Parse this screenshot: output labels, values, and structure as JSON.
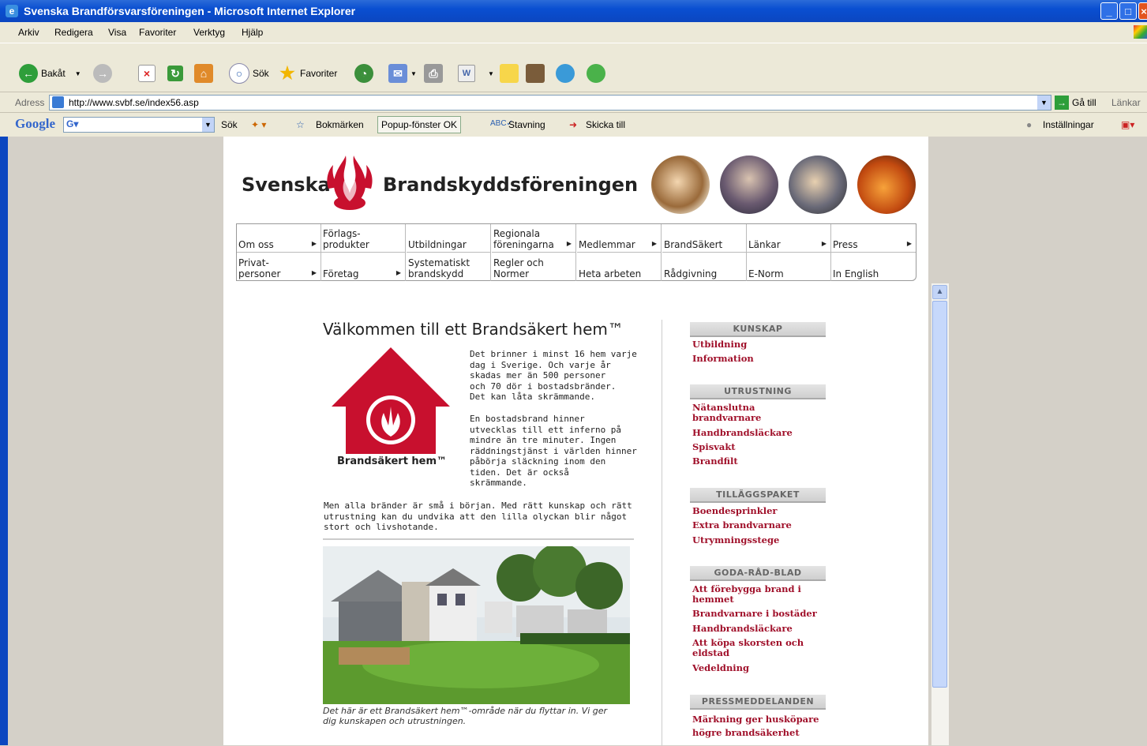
{
  "window": {
    "title": "Svenska Brandförsvarsföreningen - Microsoft Internet Explorer"
  },
  "menu": [
    "Arkiv",
    "Redigera",
    "Visa",
    "Favoriter",
    "Verktyg",
    "Hjälp"
  ],
  "toolbar": {
    "back": "Bakåt",
    "search": "Sök",
    "favorites": "Favoriter"
  },
  "address": {
    "label": "Adress",
    "url": "http://www.svbf.se/index56.asp",
    "go": "Gå till",
    "links": "Länkar"
  },
  "googlebar": {
    "logo": "Google",
    "search": "Sök",
    "bookmarks": "Bokmärken",
    "popup": "Popup-fönster OK",
    "spelling": "Stavning",
    "send": "Skicka till",
    "settings": "Inställningar"
  },
  "logo": {
    "left": "Svenska",
    "right": "Brandskyddsföreningen"
  },
  "nav": {
    "row1": [
      "Om oss",
      "Förlags-\nprodukter",
      "Utbildningar",
      "Regionala\nföreningarna",
      "Medlemmar",
      "BrandSäkert",
      "Länkar",
      "Press"
    ],
    "row2": [
      "Privat-\npersoner",
      "Företag",
      "Systematiskt\nbrandskydd",
      "Regler och\nNormer",
      "Heta arbeten",
      "Rådgivning",
      "E-Norm",
      "In English"
    ]
  },
  "main": {
    "title": "Välkommen till ett Brandsäkert hem™",
    "house_label": "Brandsäkert hem™",
    "para1": "Det brinner i minst 16 hem varje\ndag i Sverige. Och varje år\nskadas mer än 500 personer\noch 70 dör i bostadsbränder.\nDet kan låta skrämmande.",
    "para2": "En bostadsbrand hinner\nutvecklas till ett inferno på\nmindre än tre minuter. Ingen\nräddningstjänst i världen hinner\npåbörja släckning inom den\ntiden. Det är också\nskrämmande.",
    "para3": "Men alla bränder är små i början. Med rätt kunskap och rätt\nutrustning kan du undvika att den lilla olyckan blir något\nstort och livshotande.",
    "caption": "Det här är ett Brandsäkert hem™-område när du flyttar in. Vi ger\ndig kunskapen och utrustningen."
  },
  "sidebar": {
    "kunskap": {
      "title": "KUNSKAP",
      "links": [
        "Utbildning",
        "Information"
      ]
    },
    "utrustning": {
      "title": "UTRUSTNING",
      "links": [
        "Nätanslutna\nbrandvarnare",
        "Handbrandsläckare",
        "Spisvakt",
        "Brandfilt"
      ]
    },
    "tillagg": {
      "title": "TILLÄGGSPAKET",
      "links": [
        "Boendesprinkler",
        "Extra brandvarnare",
        "Utrymningsstege"
      ]
    },
    "godarad": {
      "title": "GODA-RÅD-BLAD",
      "links": [
        "Att förebygga brand i\nhemmet",
        "Brandvarnare i bostäder",
        "Handbrandsläckare",
        "Att köpa skorsten och\neldstad",
        "Vedeldning"
      ]
    },
    "press": {
      "title": "PRESSMEDDELANDEN",
      "links": [
        "Märkning ger husköpare\nhögre brandsäkerhet"
      ]
    }
  },
  "colors": {
    "link": "#a0102a",
    "brand_red": "#c8102e",
    "title_bar": "#0a4fd1"
  }
}
